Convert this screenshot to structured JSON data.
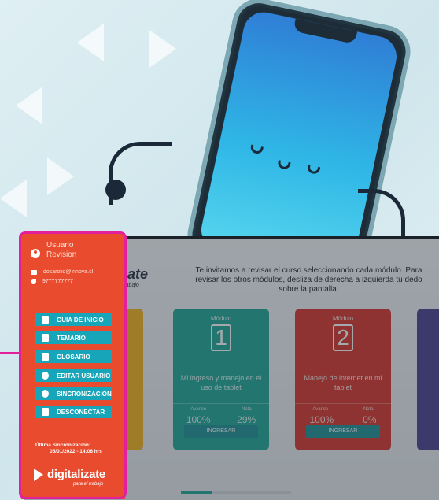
{
  "menu": {
    "user_label": "Usuario",
    "user_name": "Revision",
    "email": "dosarolio@innova.cl",
    "phone": "9777777777",
    "buttons": [
      {
        "label": "GUIA DE INICIO",
        "icon": "document-icon"
      },
      {
        "label": "TEMARIO",
        "icon": "document-icon"
      },
      {
        "label": "GLOSARIO",
        "icon": "document-icon"
      },
      {
        "label": "EDITAR USUARIO",
        "icon": "user-icon"
      },
      {
        "label": "SINCRONIZACIÓN",
        "icon": "sync-icon"
      },
      {
        "label": "DESCONECTAR",
        "icon": "logout-icon"
      }
    ],
    "sync_label": "Última Sincronización:",
    "sync_date": "05/01/2022 - 14:06 hrs",
    "brand_name": "digitalizate",
    "brand_tagline": "para el trabajo"
  },
  "app": {
    "logo": "ízate",
    "logo_tag": "el trabajo",
    "instructions": "Te invitamos a revisar el curso seleccionando cada módulo. Para revisar los otros módulos, desliza  de derecha a izquierda tu dedo sobre la pantalla.",
    "cards": [
      {
        "module_label": "Módulo",
        "number": "1",
        "title": "Mi ingreso y manejo en el uso de tablet",
        "avance_label": "Avance",
        "nota_label": "Nota",
        "avance": "100%",
        "nota": "29%",
        "button": "INGRESAR"
      },
      {
        "module_label": "Módulo",
        "number": "2",
        "title": "Manejo de internet en mi tablet",
        "avance_label": "Avance",
        "nota_label": "Nota",
        "avance": "100%",
        "nota": "0%",
        "button": "INGRESAR"
      }
    ]
  },
  "colors": {
    "menu_bg": "#e84b2d",
    "button_bg": "#17a6b9",
    "highlight": "#e41f9e",
    "card_teal": "#1fa596",
    "card_red": "#d8352a"
  }
}
